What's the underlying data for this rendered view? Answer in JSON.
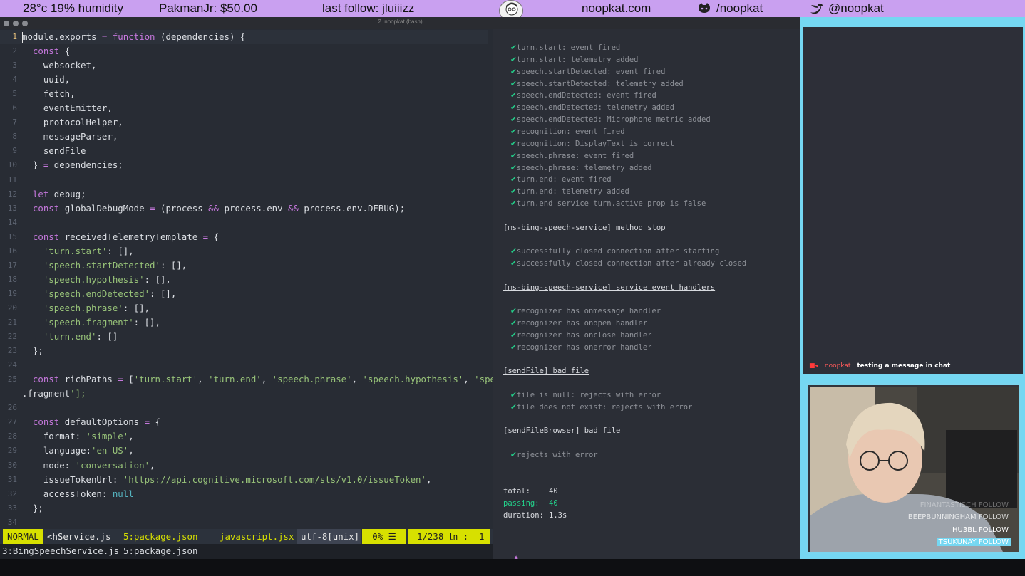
{
  "stream_bar": {
    "weather": "28°c 19% humidity",
    "donation": "PakmanJr: $50.00",
    "last_follow": "last follow: jluiiizz",
    "site": "noopkat.com",
    "github": "/noopkat",
    "twitter": "@noopkat"
  },
  "window": {
    "title": "2. noopkat (bash)"
  },
  "editor": {
    "lines": [
      {
        "n": "1",
        "code": "module.exports = function (dependencies) {"
      },
      {
        "n": "2",
        "code": "  const {"
      },
      {
        "n": "3",
        "code": "    websocket,"
      },
      {
        "n": "4",
        "code": "    uuid,"
      },
      {
        "n": "5",
        "code": "    fetch,"
      },
      {
        "n": "6",
        "code": "    eventEmitter,"
      },
      {
        "n": "7",
        "code": "    protocolHelper,"
      },
      {
        "n": "8",
        "code": "    messageParser,"
      },
      {
        "n": "9",
        "code": "    sendFile"
      },
      {
        "n": "10",
        "code": "  } = dependencies;"
      },
      {
        "n": "11",
        "code": ""
      },
      {
        "n": "12",
        "code": "  let debug;"
      },
      {
        "n": "13",
        "code": "  const globalDebugMode = (process && process.env && process.env.DEBUG);"
      },
      {
        "n": "14",
        "code": ""
      },
      {
        "n": "15",
        "code": "  const receivedTelemetryTemplate = {"
      },
      {
        "n": "16",
        "code": "    'turn.start': [],"
      },
      {
        "n": "17",
        "code": "    'speech.startDetected': [],"
      },
      {
        "n": "18",
        "code": "    'speech.hypothesis': [],"
      },
      {
        "n": "19",
        "code": "    'speech.endDetected': [],"
      },
      {
        "n": "20",
        "code": "    'speech.phrase': [],"
      },
      {
        "n": "21",
        "code": "    'speech.fragment': [],"
      },
      {
        "n": "22",
        "code": "    'turn.end': []"
      },
      {
        "n": "23",
        "code": "  };"
      },
      {
        "n": "24",
        "code": ""
      },
      {
        "n": "25",
        "code": "  const richPaths = ['turn.start', 'turn.end', 'speech.phrase', 'speech.hypothesis', 'speech"
      },
      {
        "n": "",
        "code": ".fragment'];"
      },
      {
        "n": "26",
        "code": ""
      },
      {
        "n": "27",
        "code": "  const defaultOptions = {"
      },
      {
        "n": "28",
        "code": "    format: 'simple',"
      },
      {
        "n": "29",
        "code": "    language:'en-US',"
      },
      {
        "n": "30",
        "code": "    mode: 'conversation',"
      },
      {
        "n": "31",
        "code": "    issueTokenUrl: 'https://api.cognitive.microsoft.com/sts/v1.0/issueToken',"
      },
      {
        "n": "32",
        "code": "    accessToken: null"
      },
      {
        "n": "33",
        "code": "  };"
      },
      {
        "n": "34",
        "code": ""
      }
    ]
  },
  "statusline": {
    "mode": "NORMAL",
    "buffer": "<hService.js",
    "alt_buffer": "5:package.json",
    "filetype": "javascript.jsx",
    "encoding": "utf-8[unix]",
    "percent": "0% ☰",
    "position": "1/238 ㏑ :  1"
  },
  "tabline": {
    "tab1": "3:BingSpeechService.js",
    "tab2": "5:package.json"
  },
  "terminal": {
    "checks_a": [
      "turn.start: event fired",
      "turn.start: telemetry added",
      "speech.startDetected: event fired",
      "speech.startDetected: telemetry added",
      "speech.endDetected: event fired",
      "speech.endDetected: telemetry added",
      "speech.endDetected: Microphone metric added",
      "recognition: event fired",
      "recognition: DisplayText is correct",
      "speech.phrase: event fired",
      "speech.phrase: telemetry added",
      "turn.end: event fired",
      "turn.end: telemetry added",
      "turn.end service turn.active prop is false"
    ],
    "section_stop": "[ms-bing-speech-service] method stop",
    "checks_b": [
      "successfully closed connection after starting",
      "successfully closed connection after already closed"
    ],
    "section_handlers": "[ms-bing-speech-service] service event handlers",
    "checks_c": [
      "recognizer has onmessage handler",
      "recognizer has onopen handler",
      "recognizer has onclose handler",
      "recognizer has onerror handler"
    ],
    "section_sendfile": "[sendFile] bad file",
    "checks_d": [
      "file is null: rejects with error",
      "file does not exist: rejects with error"
    ],
    "section_sendfilebrowser": "[sendFileBrowser] bad file",
    "checks_e": [
      "rejects with error"
    ],
    "total_label": "total:",
    "total_value": "40",
    "passing_label": "passing:",
    "passing_value": "40",
    "duration_label": "duration:",
    "duration_value": "1.3s",
    "prompt": "$"
  },
  "chat": {
    "user": "noopkat",
    "message": "testing a message in chat"
  },
  "follows": [
    {
      "name": "FINANTASTISCH",
      "action": "FOLLOW"
    },
    {
      "name": "BEEPBUNNINGHAM",
      "action": "FOLLOW"
    },
    {
      "name": "HU3BL",
      "action": "FOLLOW"
    },
    {
      "name": "TSUKUNAY",
      "action": "FOLLOW"
    }
  ],
  "colors": {
    "stream_bar": "#c9a0f0",
    "accent_green": "#23d18b",
    "statusline_yellow": "#d7e000",
    "frame_cyan": "#75d7f2"
  },
  "icons": [
    "github-icon",
    "twitter-icon",
    "camera-icon",
    "avatar"
  ]
}
